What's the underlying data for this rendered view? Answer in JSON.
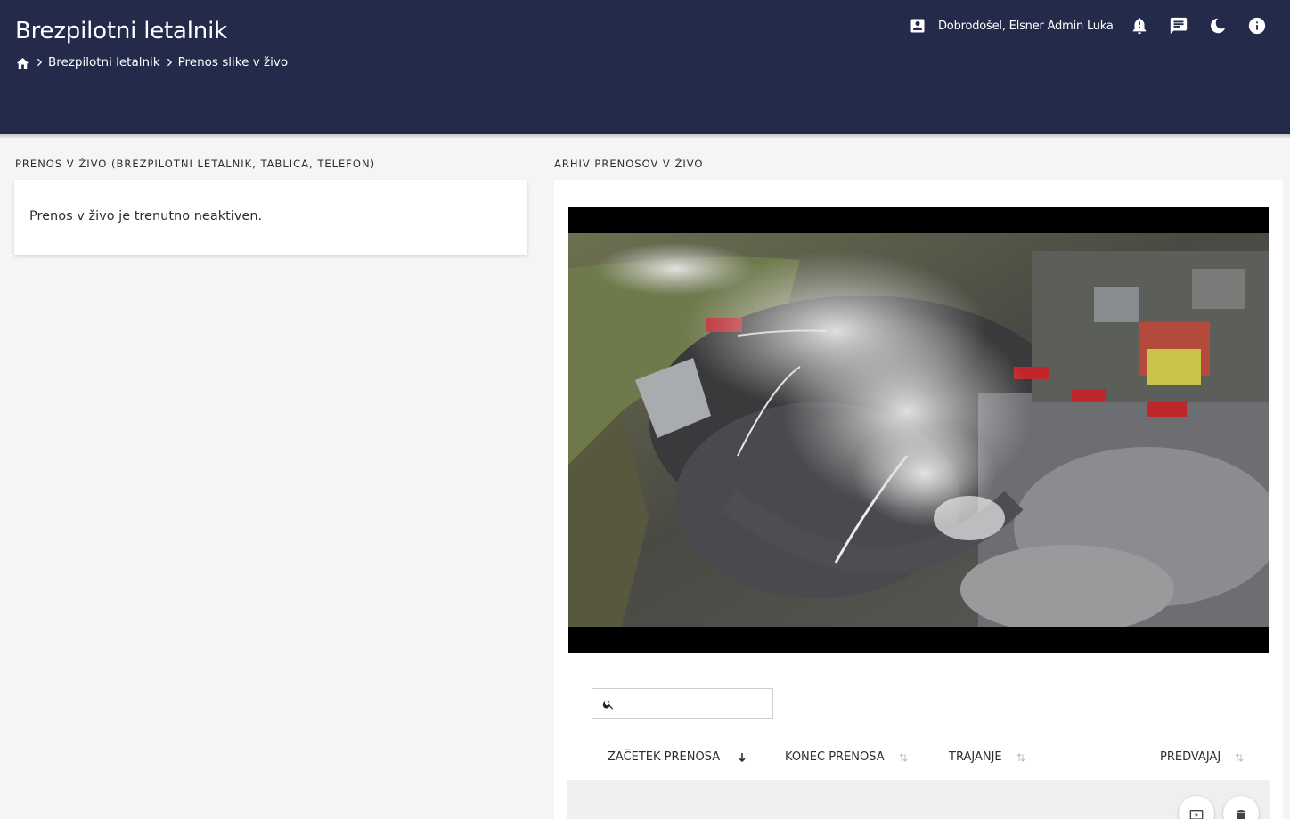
{
  "header": {
    "title": "Brezpilotni letalnik",
    "breadcrumb": [
      "Brezpilotni letalnik",
      "Prenos slike v živo"
    ],
    "user_greeting": "Dobrodošel, Elsner Admin Luka",
    "icons": [
      "home-icon",
      "account-box-icon",
      "bell-alert-icon",
      "message-icon",
      "dark-mode-icon",
      "info-icon"
    ]
  },
  "left_panel": {
    "title": "PRENOS V ŽIVO (BREZPILOTNI LETALNIK, TABLICA, TELEFON)",
    "status_text": "Prenos v živo je trenutno neaktiven."
  },
  "right_panel": {
    "title": "ARHIV PRENOSOV V ŽIVO",
    "search_placeholder": "",
    "columns": [
      "ZAČETEK PRENOSA",
      "KONEC PRENOSA",
      "TRAJANJE",
      "PREDVAJAJ"
    ],
    "sorted_column": "ZAČETEK PRENOSA",
    "row_actions": [
      "play-video-icon",
      "delete-icon"
    ]
  },
  "colors": {
    "header_bg": "#232a4a",
    "page_bg": "#f5f5f5",
    "card_bg": "#ffffff",
    "text": "#2c2c35"
  }
}
